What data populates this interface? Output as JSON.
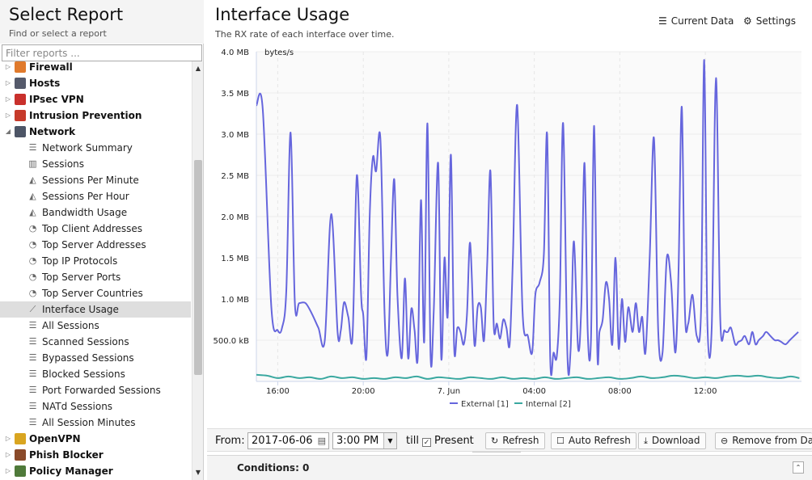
{
  "left": {
    "title": "Select Report",
    "subtitle": "Find or select a report",
    "filter_placeholder": "Filter reports ...",
    "categories_top": [
      {
        "label": "Firewall",
        "color": "#e07a2c",
        "icon": "firewall-icon"
      },
      {
        "label": "Hosts",
        "color": "#555a6b",
        "icon": "hosts-icon"
      },
      {
        "label": "IPsec VPN",
        "color": "#c9302c",
        "icon": "lock-icon"
      },
      {
        "label": "Intrusion Prevention",
        "color": "#c63a2a",
        "icon": "intrusion-prevention-icon"
      },
      {
        "label": "Network",
        "color": "#4d5566",
        "icon": "network-icon"
      }
    ],
    "network_reports": [
      {
        "label": "Network Summary",
        "icon": "list-icon"
      },
      {
        "label": "Sessions",
        "icon": "bar-chart-icon"
      },
      {
        "label": "Sessions Per Minute",
        "icon": "area-chart-icon"
      },
      {
        "label": "Sessions Per Hour",
        "icon": "area-chart-icon"
      },
      {
        "label": "Bandwidth Usage",
        "icon": "area-chart-icon"
      },
      {
        "label": "Top Client Addresses",
        "icon": "pie-chart-icon"
      },
      {
        "label": "Top Server Addresses",
        "icon": "pie-chart-icon"
      },
      {
        "label": "Top IP Protocols",
        "icon": "pie-chart-icon"
      },
      {
        "label": "Top Server Ports",
        "icon": "pie-chart-icon"
      },
      {
        "label": "Top Server Countries",
        "icon": "pie-chart-icon"
      },
      {
        "label": "Interface Usage",
        "icon": "line-chart-icon"
      },
      {
        "label": "All Sessions",
        "icon": "list-icon"
      },
      {
        "label": "Scanned Sessions",
        "icon": "list-icon"
      },
      {
        "label": "Bypassed Sessions",
        "icon": "list-icon"
      },
      {
        "label": "Blocked Sessions",
        "icon": "list-icon"
      },
      {
        "label": "Port Forwarded Sessions",
        "icon": "list-icon"
      },
      {
        "label": "NATd Sessions",
        "icon": "list-icon"
      },
      {
        "label": "All Session Minutes",
        "icon": "list-icon"
      }
    ],
    "categories_bottom": [
      {
        "label": "OpenVPN",
        "color": "#d9a520",
        "icon": "openvpn-icon"
      },
      {
        "label": "Phish Blocker",
        "color": "#8a4a2a",
        "icon": "phish-blocker-icon"
      },
      {
        "label": "Policy Manager",
        "color": "#4f7a3a",
        "icon": "policy-manager-icon"
      }
    ]
  },
  "right": {
    "title": "Interface Usage",
    "subtitle": "The RX rate of each interface over time.",
    "current_data_label": "Current Data",
    "settings_label": "Settings"
  },
  "toolbar": {
    "from_label": "From:",
    "from_date": "2017-06-06",
    "from_time": "3:00 PM",
    "till_label": "till",
    "present_label": "Present",
    "present_checked": true,
    "refresh_label": "Refresh",
    "auto_refresh_label": "Auto Refresh",
    "download_label": "Download",
    "remove_label": "Remove from Das"
  },
  "conditions": {
    "label": "Conditions: 0"
  },
  "chart_data": {
    "type": "line",
    "ylabel": "bytes/s",
    "y_ticks": [
      "500.0 kB",
      "1.0 MB",
      "1.5 MB",
      "2.0 MB",
      "2.5 MB",
      "3.0 MB",
      "3.5 MB",
      "4.0 MB"
    ],
    "ylim": [
      0,
      4.0
    ],
    "y_unit": "MB",
    "x_ticks": [
      "16:00",
      "20:00",
      "7. Jun",
      "04:00",
      "08:00",
      "12:00"
    ],
    "x_tick_hours": [
      1,
      5,
      9,
      13,
      17,
      21
    ],
    "xlim_hours": [
      0,
      25.5
    ],
    "x_origin": "2017-06-06 15:00",
    "grid": true,
    "legend_position": "bottom-center",
    "series": [
      {
        "name": "External [1]",
        "color": "#6666dd",
        "x": [
          0,
          0.3,
          0.7,
          1.0,
          1.2,
          1.4,
          1.6,
          1.8,
          2.0,
          2.3,
          2.6,
          2.9,
          3.2,
          3.5,
          3.8,
          3.95,
          4.1,
          4.3,
          4.5,
          4.7,
          4.9,
          5.0,
          5.15,
          5.3,
          5.45,
          5.6,
          5.8,
          6.0,
          6.15,
          6.3,
          6.45,
          6.6,
          6.8,
          6.95,
          7.1,
          7.25,
          7.4,
          7.55,
          7.7,
          7.85,
          8.0,
          8.15,
          8.3,
          8.5,
          8.65,
          8.8,
          8.95,
          9.1,
          9.25,
          9.4,
          9.55,
          9.7,
          9.85,
          10.0,
          10.2,
          10.35,
          10.5,
          10.65,
          10.8,
          10.95,
          11.1,
          11.25,
          11.4,
          11.55,
          11.7,
          11.85,
          12.0,
          12.2,
          12.45,
          12.7,
          12.9,
          13.05,
          13.25,
          13.45,
          13.6,
          13.75,
          13.9,
          14.05,
          14.2,
          14.35,
          14.55,
          14.7,
          14.85,
          15.05,
          15.2,
          15.35,
          15.5,
          15.65,
          15.8,
          15.95,
          16.05,
          16.2,
          16.35,
          16.5,
          16.65,
          16.8,
          16.95,
          17.1,
          17.25,
          17.4,
          17.6,
          17.75,
          17.9,
          18.05,
          18.2,
          18.4,
          18.6,
          18.8,
          19.0,
          19.2,
          19.4,
          19.6,
          19.75,
          19.9,
          20.05,
          20.2,
          20.4,
          20.6,
          20.8,
          20.95,
          21.1,
          21.3,
          21.5,
          21.7,
          21.9,
          22.05,
          22.2,
          22.4,
          22.55,
          22.7,
          22.85,
          23.05,
          23.2,
          23.35,
          23.5,
          23.7,
          23.85,
          24.05,
          24.25,
          24.4,
          24.55,
          24.75,
          24.95,
          25.15,
          25.35
        ],
        "values": [
          3.35,
          3.3,
          0.9,
          0.62,
          0.65,
          1.1,
          3.02,
          0.95,
          0.95,
          0.95,
          0.82,
          0.65,
          0.5,
          2.03,
          0.6,
          0.62,
          0.96,
          0.78,
          0.55,
          2.5,
          1.05,
          0.8,
          0.3,
          2.0,
          2.72,
          2.55,
          2.95,
          0.8,
          0.35,
          1.5,
          2.45,
          1.05,
          0.28,
          1.25,
          0.28,
          0.88,
          0.62,
          0.3,
          2.2,
          0.48,
          3.13,
          0.3,
          0.88,
          2.65,
          0.28,
          1.5,
          0.8,
          2.75,
          0.42,
          0.65,
          0.6,
          0.45,
          0.8,
          1.68,
          0.45,
          0.9,
          0.9,
          0.5,
          1.45,
          2.55,
          0.7,
          0.7,
          0.52,
          0.75,
          0.65,
          0.45,
          1.5,
          3.35,
          0.85,
          0.55,
          0.35,
          1.05,
          1.2,
          1.55,
          3.0,
          0.25,
          0.35,
          0.3,
          1.05,
          3.13,
          0.32,
          0.38,
          1.7,
          0.4,
          0.92,
          2.65,
          0.6,
          0.5,
          3.1,
          0.35,
          0.6,
          0.75,
          1.2,
          1.0,
          0.45,
          1.5,
          0.4,
          1.0,
          0.48,
          0.9,
          0.6,
          0.95,
          0.6,
          0.78,
          0.35,
          1.5,
          2.95,
          0.6,
          0.35,
          1.5,
          1.2,
          0.35,
          1.35,
          3.33,
          0.85,
          0.7,
          1.05,
          0.55,
          0.85,
          3.9,
          0.7,
          0.65,
          3.68,
          0.75,
          0.62,
          0.6,
          0.65,
          0.45,
          0.48,
          0.5,
          0.55,
          0.45,
          0.6,
          0.45,
          0.5,
          0.55,
          0.6,
          0.55,
          0.5,
          0.5,
          0.48,
          0.45,
          0.5,
          0.55,
          0.6
        ]
      },
      {
        "name": "Internal [2]",
        "color": "#3aa8a0",
        "x": [
          0,
          0.5,
          1.0,
          1.5,
          2.0,
          2.5,
          3.0,
          3.5,
          4.0,
          4.5,
          5.0,
          5.5,
          6.0,
          6.5,
          7.0,
          7.5,
          8.0,
          8.5,
          9.0,
          9.5,
          10.0,
          10.5,
          11.0,
          11.5,
          12.0,
          12.5,
          13.0,
          13.5,
          14.0,
          14.5,
          15.0,
          15.5,
          16.0,
          16.5,
          17.0,
          17.5,
          18.0,
          18.5,
          19.0,
          19.5,
          20.0,
          20.5,
          21.0,
          21.5,
          22.0,
          22.5,
          23.0,
          23.5,
          24.0,
          24.5,
          25.0,
          25.4
        ],
        "values": [
          0.08,
          0.07,
          0.04,
          0.06,
          0.04,
          0.05,
          0.03,
          0.06,
          0.04,
          0.05,
          0.03,
          0.04,
          0.03,
          0.05,
          0.04,
          0.06,
          0.03,
          0.05,
          0.04,
          0.03,
          0.05,
          0.04,
          0.03,
          0.05,
          0.03,
          0.04,
          0.03,
          0.05,
          0.03,
          0.04,
          0.05,
          0.03,
          0.04,
          0.05,
          0.03,
          0.04,
          0.06,
          0.04,
          0.05,
          0.07,
          0.06,
          0.04,
          0.05,
          0.04,
          0.06,
          0.07,
          0.06,
          0.07,
          0.05,
          0.04,
          0.06,
          0.04
        ]
      }
    ]
  }
}
